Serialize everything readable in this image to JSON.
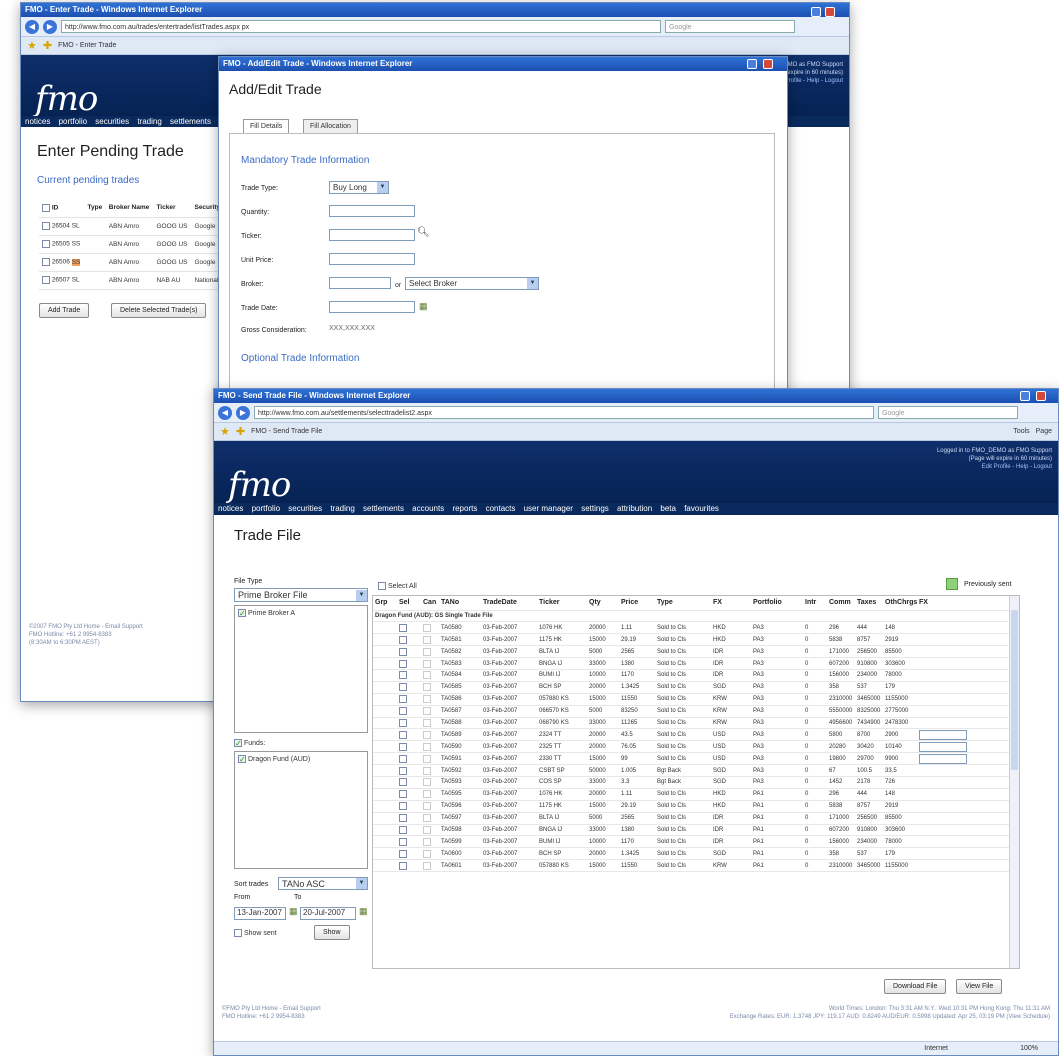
{
  "window1": {
    "title": "FMO - Enter Trade - Windows Internet Explorer",
    "url": "http://www.fmo.com.au/trades/entertrade/listTrades.aspx px",
    "tab": "FMO - Enter Trade",
    "search": "Google",
    "menu": [
      "notices",
      "portfolio",
      "securities",
      "trading",
      "settlements"
    ],
    "page_title": "Enter Pending Trade",
    "subtitle": "Current pending trades",
    "columns": [
      "ID",
      "Type",
      "Broker Name",
      "Ticker",
      "Security"
    ],
    "rows": [
      [
        "26504",
        "SL",
        "ABN Amro",
        "GOOG US",
        "Google"
      ],
      [
        "26505",
        "SS",
        "ABN Amro",
        "GOOG US",
        "Google"
      ],
      [
        "26506",
        "SS",
        "ABN Amro",
        "GOOG US",
        "Google"
      ],
      [
        "26507",
        "SL",
        "ABN Amro",
        "NAB AU",
        "National"
      ]
    ],
    "add_button": "Add Trade",
    "delete_button": "Delete Selected Trade(s)",
    "footer": [
      "©2007 FMO Pty Ltd Home - Email Support",
      "FMO Hotline: +61 2 9954-8383",
      "(8:30AM to 6:30PM AEST)"
    ],
    "header_right": [
      "EMO as FMO Support",
      "will expire in 60 minutes)",
      "t Profile - Help - Logout"
    ]
  },
  "window2": {
    "title": "FMO - Add/Edit Trade - Windows Internet Explorer",
    "page_title": "Add/Edit Trade",
    "tabs": [
      "Fill Details",
      "Fill Allocation"
    ],
    "section1": "Mandatory Trade Information",
    "labels": {
      "trade_type": "Trade Type:",
      "quantity": "Quantity:",
      "ticker": "Ticker:",
      "unit_price": "Unit Price:",
      "broker": "Broker:",
      "trade_date": "Trade Date:",
      "gross": "Gross Consideration:"
    },
    "trade_type_value": "Buy Long",
    "or_text": "or",
    "broker_select": "Select Broker",
    "gross_value": "XXX,XXX.XXX",
    "section2": "Optional Trade Information"
  },
  "window3": {
    "title": "FMO - Send Trade File - Windows Internet Explorer",
    "url": "http://www.fmo.com.au/settlements/selecttradelist2.aspx",
    "tab": "FMO - Send Trade File",
    "search": "Google",
    "toolbar": [
      "Tools",
      "Page"
    ],
    "header_right": [
      "Logged in to FMO_DEMO as FMO Support",
      "(Page will expire in 60 minutes)",
      "Edit Profile - Help - Logout"
    ],
    "menu": [
      "notices",
      "portfolio",
      "securities",
      "trading",
      "settlements",
      "accounts",
      "reports",
      "contacts",
      "user manager",
      "settings",
      "attribution",
      "beta",
      "favourites"
    ],
    "page_title": "Trade File",
    "file_type_label": "File Type",
    "file_type_value": "Prime Broker File",
    "prime_broker": "Prime Broker A",
    "funds_label": "Funds:",
    "fund": "Dragon Fund (AUD)",
    "sort_label": "Sort trades",
    "sort_value": "TANo ASC",
    "from_label": "From",
    "to_label": "To",
    "from_value": "13-Jan-2007",
    "to_value": "20-Jul-2007",
    "show_sent": "Show sent",
    "show_button": "Show",
    "select_all": "Select All",
    "previously_sent": "Previously sent",
    "columns": [
      "Grp",
      "Sel",
      "Can",
      "TANo",
      "TradeDate",
      "Ticker",
      "Qty",
      "Price",
      "Type",
      "FX",
      "Portfolio",
      "Intr",
      "Comm",
      "Taxes",
      "OthChrgs",
      "FX"
    ],
    "group_label": "Dragon Fund (AUD): GS Single Trade File",
    "rows": [
      [
        "TA0580",
        "03-Feb-2007",
        "1076 HK",
        "20000",
        "1.11",
        "Sold to Cls",
        "HKD",
        "PA3",
        "0",
        "296",
        "444",
        "148"
      ],
      [
        "TA0581",
        "03-Feb-2007",
        "1175 HK",
        "15000",
        "29.19",
        "Sold to Cls",
        "HKD",
        "PA3",
        "0",
        "5838",
        "8757",
        "2919"
      ],
      [
        "TA0582",
        "03-Feb-2007",
        "BLTA IJ",
        "5000",
        "2565",
        "Sold to Cls",
        "IDR",
        "PA3",
        "0",
        "171000",
        "256500",
        "85500"
      ],
      [
        "TA0583",
        "03-Feb-2007",
        "BNGA IJ",
        "33000",
        "1380",
        "Sold to Cls",
        "IDR",
        "PA3",
        "0",
        "607200",
        "910800",
        "303600"
      ],
      [
        "TA0584",
        "03-Feb-2007",
        "BUMI IJ",
        "10000",
        "1170",
        "Sold to Cls",
        "IDR",
        "PA3",
        "0",
        "156000",
        "234000",
        "78000"
      ],
      [
        "TA0585",
        "03-Feb-2007",
        "BCH SP",
        "20000",
        "1.3425",
        "Sold to Cls",
        "SGD",
        "PA3",
        "0",
        "358",
        "537",
        "179"
      ],
      [
        "TA0586",
        "03-Feb-2007",
        "057880 KS",
        "15000",
        "11550",
        "Sold to Cls",
        "KRW",
        "PA3",
        "0",
        "2310000",
        "3465000",
        "1155000"
      ],
      [
        "TA0587",
        "03-Feb-2007",
        "066570 KS",
        "5000",
        "83250",
        "Sold to Cls",
        "KRW",
        "PA3",
        "0",
        "5550000",
        "8325000",
        "2775000"
      ],
      [
        "TA0588",
        "03-Feb-2007",
        "068790 KS",
        "33000",
        "11265",
        "Sold to Cls",
        "KRW",
        "PA3",
        "0",
        "4956600",
        "7434900",
        "2478300"
      ],
      [
        "TA0589",
        "03-Feb-2007",
        "2324 TT",
        "20000",
        "43.5",
        "Sold to Cls",
        "USD",
        "PA3",
        "0",
        "5800",
        "8700",
        "2900"
      ],
      [
        "TA0590",
        "03-Feb-2007",
        "2325 TT",
        "20000",
        "76.05",
        "Sold to Cls",
        "USD",
        "PA3",
        "0",
        "20280",
        "30420",
        "10140"
      ],
      [
        "TA0591",
        "03-Feb-2007",
        "2330 TT",
        "15000",
        "99",
        "Sold to Cls",
        "USD",
        "PA3",
        "0",
        "19800",
        "29700",
        "9900"
      ],
      [
        "TA0592",
        "03-Feb-2007",
        "CSBT SP",
        "50000",
        "1.005",
        "Bgt Back",
        "SGD",
        "PA3",
        "0",
        "67",
        "100.5",
        "33.5"
      ],
      [
        "TA0593",
        "03-Feb-2007",
        "COS SP",
        "33000",
        "3.3",
        "Bgt Back",
        "SGD",
        "PA3",
        "0",
        "1452",
        "2178",
        "726"
      ],
      [
        "TA0595",
        "03-Feb-2007",
        "1076 HK",
        "20000",
        "1.11",
        "Sold to Cls",
        "HKD",
        "PA1",
        "0",
        "296",
        "444",
        "148"
      ],
      [
        "TA0596",
        "03-Feb-2007",
        "1175 HK",
        "15000",
        "29.19",
        "Sold to Cls",
        "HKD",
        "PA1",
        "0",
        "5838",
        "8757",
        "2919"
      ],
      [
        "TA0597",
        "03-Feb-2007",
        "BLTA IJ",
        "5000",
        "2565",
        "Sold to Cls",
        "IDR",
        "PA1",
        "0",
        "171000",
        "256500",
        "85500"
      ],
      [
        "TA0598",
        "03-Feb-2007",
        "BNGA IJ",
        "33000",
        "1380",
        "Sold to Cls",
        "IDR",
        "PA1",
        "0",
        "607200",
        "910800",
        "303600"
      ],
      [
        "TA0599",
        "03-Feb-2007",
        "BUMI IJ",
        "10000",
        "1170",
        "Sold to Cls",
        "IDR",
        "PA1",
        "0",
        "156000",
        "234000",
        "78000"
      ],
      [
        "TA0600",
        "03-Feb-2007",
        "BCH SP",
        "20000",
        "1.3425",
        "Sold to Cls",
        "SGD",
        "PA1",
        "0",
        "358",
        "537",
        "179"
      ],
      [
        "TA0601",
        "03-Feb-2007",
        "057880 KS",
        "15000",
        "11550",
        "Sold to Cls",
        "KRW",
        "PA1",
        "0",
        "2310000",
        "3465000",
        "1155000"
      ]
    ],
    "download_button": "Download File",
    "view_button": "View File",
    "footer_left": [
      "©FMO Pty Ltd Home - Email Support",
      "FMO Hotline: +61 2 9954-8383"
    ],
    "footer_right": [
      "World Times: London: Thu 3:31 AM   N.Y.: Wed 10:31 PM   Hong Kong: Thu 11:31 AM",
      "Exchange Rates: EUR: 1.3748  JPY: 119.17  AUD: 0.8249  AUD/EUR: 0.5998  Updated: Apr 25, 03:19 PM (View Schedule)"
    ],
    "status": [
      "Internet",
      "100%"
    ]
  },
  "colors": {
    "header": "#0f2f6b",
    "titlebar": "#2f72d6",
    "accent": "#3a6cc4",
    "prev_sent": "#8fd07a"
  }
}
